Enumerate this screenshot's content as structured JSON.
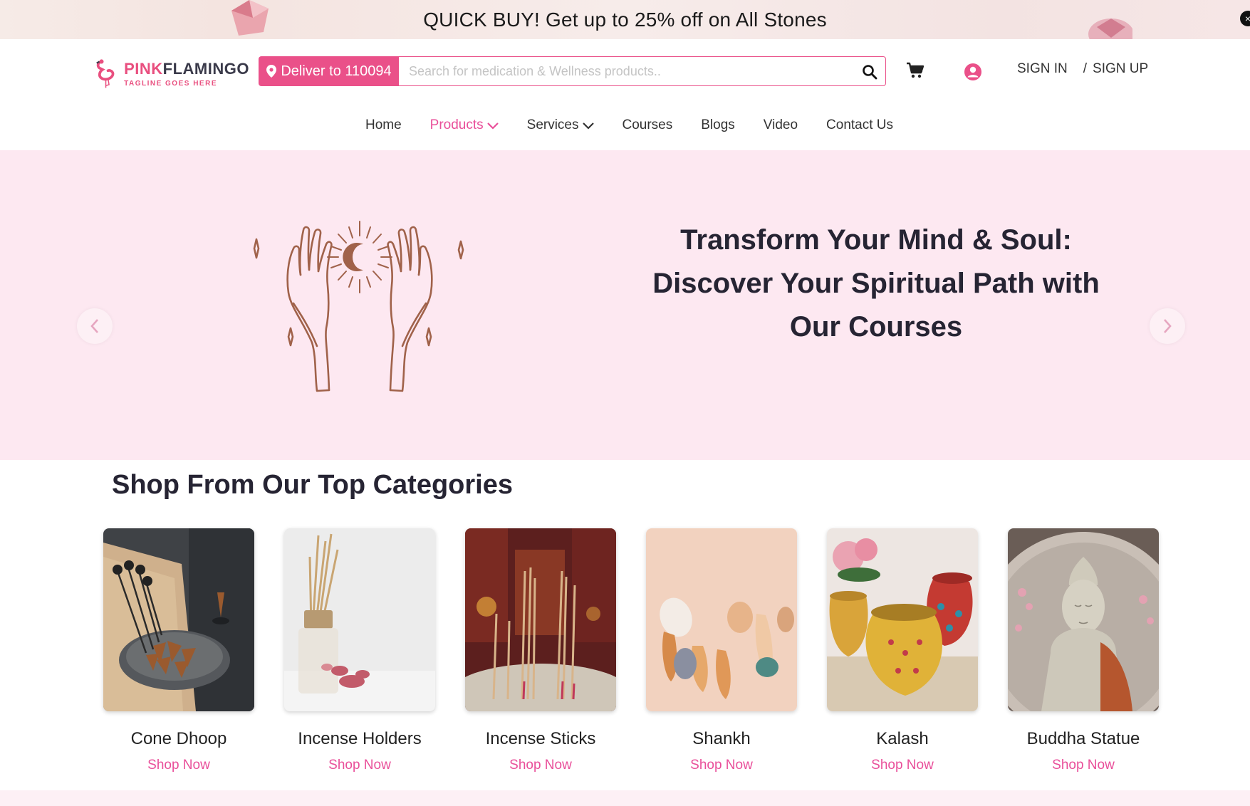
{
  "promo": {
    "text": "QUICK BUY! Get up to 25% off on All Stones",
    "close": "×"
  },
  "header": {
    "logo": {
      "name_pink": "PINK",
      "name_dark": "FLAMINGO",
      "tagline": "TAGLINE GOES HERE"
    },
    "deliver_label": "Deliver to 110094",
    "search": {
      "placeholder": "Search for medication & Wellness products.."
    },
    "auth": {
      "sign_in": "SIGN IN",
      "separator": "/",
      "sign_up": "SIGN UP"
    }
  },
  "nav": {
    "home": "Home",
    "products": "Products",
    "services": "Services",
    "courses": "Courses",
    "blogs": "Blogs",
    "video": "Video",
    "contact": "Contact Us"
  },
  "hero": {
    "title_line1": "Transform Your Mind & Soul:",
    "title_line2": "Discover Your Spiritual Path with",
    "title_line3": "Our Courses"
  },
  "categories": {
    "title": "Shop From Our Top Categories",
    "items": [
      {
        "name": "Cone Dhoop",
        "link": "Shop Now"
      },
      {
        "name": "Incense Holders",
        "link": "Shop Now"
      },
      {
        "name": "Incense Sticks",
        "link": "Shop Now"
      },
      {
        "name": "Shankh",
        "link": "Shop Now"
      },
      {
        "name": "Kalash",
        "link": "Shop Now"
      },
      {
        "name": "Buddha Statue",
        "link": "Shop Now"
      }
    ]
  },
  "colors": {
    "accent": "#ea5089",
    "hero_bg": "#fde8f1",
    "illustration": "#a0624a"
  }
}
